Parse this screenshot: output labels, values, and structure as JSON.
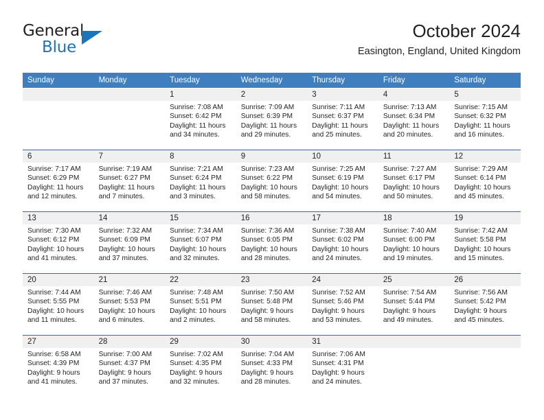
{
  "brand": {
    "name_top": "General",
    "name_bottom": "Blue",
    "triangle_color": "#1b75bb",
    "text_color": "#231f20"
  },
  "header": {
    "title": "October 2024",
    "subtitle": "Easington, England, United Kingdom"
  },
  "theme": {
    "header_row_bg": "#3f7fbf",
    "header_row_text": "#ffffff",
    "date_band_bg": "#f0f0f0",
    "week_separator": "#2f6aa8",
    "body_text": "#231f20"
  },
  "weekday_headers": [
    "Sunday",
    "Monday",
    "Tuesday",
    "Wednesday",
    "Thursday",
    "Friday",
    "Saturday"
  ],
  "labels": {
    "sunrise_prefix": "Sunrise:",
    "sunset_prefix": "Sunset:",
    "daylight_prefix": "Daylight:"
  },
  "weeks": [
    [
      {
        "date": "",
        "empty": true
      },
      {
        "date": "",
        "empty": true
      },
      {
        "date": "1",
        "sunrise": "Sunrise: 7:08 AM",
        "sunset": "Sunset: 6:42 PM",
        "daylight_line1": "Daylight: 11 hours",
        "daylight_line2": "and 34 minutes."
      },
      {
        "date": "2",
        "sunrise": "Sunrise: 7:09 AM",
        "sunset": "Sunset: 6:39 PM",
        "daylight_line1": "Daylight: 11 hours",
        "daylight_line2": "and 29 minutes."
      },
      {
        "date": "3",
        "sunrise": "Sunrise: 7:11 AM",
        "sunset": "Sunset: 6:37 PM",
        "daylight_line1": "Daylight: 11 hours",
        "daylight_line2": "and 25 minutes."
      },
      {
        "date": "4",
        "sunrise": "Sunrise: 7:13 AM",
        "sunset": "Sunset: 6:34 PM",
        "daylight_line1": "Daylight: 11 hours",
        "daylight_line2": "and 20 minutes."
      },
      {
        "date": "5",
        "sunrise": "Sunrise: 7:15 AM",
        "sunset": "Sunset: 6:32 PM",
        "daylight_line1": "Daylight: 11 hours",
        "daylight_line2": "and 16 minutes."
      }
    ],
    [
      {
        "date": "6",
        "sunrise": "Sunrise: 7:17 AM",
        "sunset": "Sunset: 6:29 PM",
        "daylight_line1": "Daylight: 11 hours",
        "daylight_line2": "and 12 minutes."
      },
      {
        "date": "7",
        "sunrise": "Sunrise: 7:19 AM",
        "sunset": "Sunset: 6:27 PM",
        "daylight_line1": "Daylight: 11 hours",
        "daylight_line2": "and 7 minutes."
      },
      {
        "date": "8",
        "sunrise": "Sunrise: 7:21 AM",
        "sunset": "Sunset: 6:24 PM",
        "daylight_line1": "Daylight: 11 hours",
        "daylight_line2": "and 3 minutes."
      },
      {
        "date": "9",
        "sunrise": "Sunrise: 7:23 AM",
        "sunset": "Sunset: 6:22 PM",
        "daylight_line1": "Daylight: 10 hours",
        "daylight_line2": "and 58 minutes."
      },
      {
        "date": "10",
        "sunrise": "Sunrise: 7:25 AM",
        "sunset": "Sunset: 6:19 PM",
        "daylight_line1": "Daylight: 10 hours",
        "daylight_line2": "and 54 minutes."
      },
      {
        "date": "11",
        "sunrise": "Sunrise: 7:27 AM",
        "sunset": "Sunset: 6:17 PM",
        "daylight_line1": "Daylight: 10 hours",
        "daylight_line2": "and 50 minutes."
      },
      {
        "date": "12",
        "sunrise": "Sunrise: 7:29 AM",
        "sunset": "Sunset: 6:14 PM",
        "daylight_line1": "Daylight: 10 hours",
        "daylight_line2": "and 45 minutes."
      }
    ],
    [
      {
        "date": "13",
        "sunrise": "Sunrise: 7:30 AM",
        "sunset": "Sunset: 6:12 PM",
        "daylight_line1": "Daylight: 10 hours",
        "daylight_line2": "and 41 minutes."
      },
      {
        "date": "14",
        "sunrise": "Sunrise: 7:32 AM",
        "sunset": "Sunset: 6:09 PM",
        "daylight_line1": "Daylight: 10 hours",
        "daylight_line2": "and 37 minutes."
      },
      {
        "date": "15",
        "sunrise": "Sunrise: 7:34 AM",
        "sunset": "Sunset: 6:07 PM",
        "daylight_line1": "Daylight: 10 hours",
        "daylight_line2": "and 32 minutes."
      },
      {
        "date": "16",
        "sunrise": "Sunrise: 7:36 AM",
        "sunset": "Sunset: 6:05 PM",
        "daylight_line1": "Daylight: 10 hours",
        "daylight_line2": "and 28 minutes."
      },
      {
        "date": "17",
        "sunrise": "Sunrise: 7:38 AM",
        "sunset": "Sunset: 6:02 PM",
        "daylight_line1": "Daylight: 10 hours",
        "daylight_line2": "and 24 minutes."
      },
      {
        "date": "18",
        "sunrise": "Sunrise: 7:40 AM",
        "sunset": "Sunset: 6:00 PM",
        "daylight_line1": "Daylight: 10 hours",
        "daylight_line2": "and 19 minutes."
      },
      {
        "date": "19",
        "sunrise": "Sunrise: 7:42 AM",
        "sunset": "Sunset: 5:58 PM",
        "daylight_line1": "Daylight: 10 hours",
        "daylight_line2": "and 15 minutes."
      }
    ],
    [
      {
        "date": "20",
        "sunrise": "Sunrise: 7:44 AM",
        "sunset": "Sunset: 5:55 PM",
        "daylight_line1": "Daylight: 10 hours",
        "daylight_line2": "and 11 minutes."
      },
      {
        "date": "21",
        "sunrise": "Sunrise: 7:46 AM",
        "sunset": "Sunset: 5:53 PM",
        "daylight_line1": "Daylight: 10 hours",
        "daylight_line2": "and 6 minutes."
      },
      {
        "date": "22",
        "sunrise": "Sunrise: 7:48 AM",
        "sunset": "Sunset: 5:51 PM",
        "daylight_line1": "Daylight: 10 hours",
        "daylight_line2": "and 2 minutes."
      },
      {
        "date": "23",
        "sunrise": "Sunrise: 7:50 AM",
        "sunset": "Sunset: 5:48 PM",
        "daylight_line1": "Daylight: 9 hours",
        "daylight_line2": "and 58 minutes."
      },
      {
        "date": "24",
        "sunrise": "Sunrise: 7:52 AM",
        "sunset": "Sunset: 5:46 PM",
        "daylight_line1": "Daylight: 9 hours",
        "daylight_line2": "and 53 minutes."
      },
      {
        "date": "25",
        "sunrise": "Sunrise: 7:54 AM",
        "sunset": "Sunset: 5:44 PM",
        "daylight_line1": "Daylight: 9 hours",
        "daylight_line2": "and 49 minutes."
      },
      {
        "date": "26",
        "sunrise": "Sunrise: 7:56 AM",
        "sunset": "Sunset: 5:42 PM",
        "daylight_line1": "Daylight: 9 hours",
        "daylight_line2": "and 45 minutes."
      }
    ],
    [
      {
        "date": "27",
        "sunrise": "Sunrise: 6:58 AM",
        "sunset": "Sunset: 4:39 PM",
        "daylight_line1": "Daylight: 9 hours",
        "daylight_line2": "and 41 minutes."
      },
      {
        "date": "28",
        "sunrise": "Sunrise: 7:00 AM",
        "sunset": "Sunset: 4:37 PM",
        "daylight_line1": "Daylight: 9 hours",
        "daylight_line2": "and 37 minutes."
      },
      {
        "date": "29",
        "sunrise": "Sunrise: 7:02 AM",
        "sunset": "Sunset: 4:35 PM",
        "daylight_line1": "Daylight: 9 hours",
        "daylight_line2": "and 32 minutes."
      },
      {
        "date": "30",
        "sunrise": "Sunrise: 7:04 AM",
        "sunset": "Sunset: 4:33 PM",
        "daylight_line1": "Daylight: 9 hours",
        "daylight_line2": "and 28 minutes."
      },
      {
        "date": "31",
        "sunrise": "Sunrise: 7:06 AM",
        "sunset": "Sunset: 4:31 PM",
        "daylight_line1": "Daylight: 9 hours",
        "daylight_line2": "and 24 minutes."
      },
      {
        "date": "",
        "empty": true
      },
      {
        "date": "",
        "empty": true
      }
    ]
  ]
}
